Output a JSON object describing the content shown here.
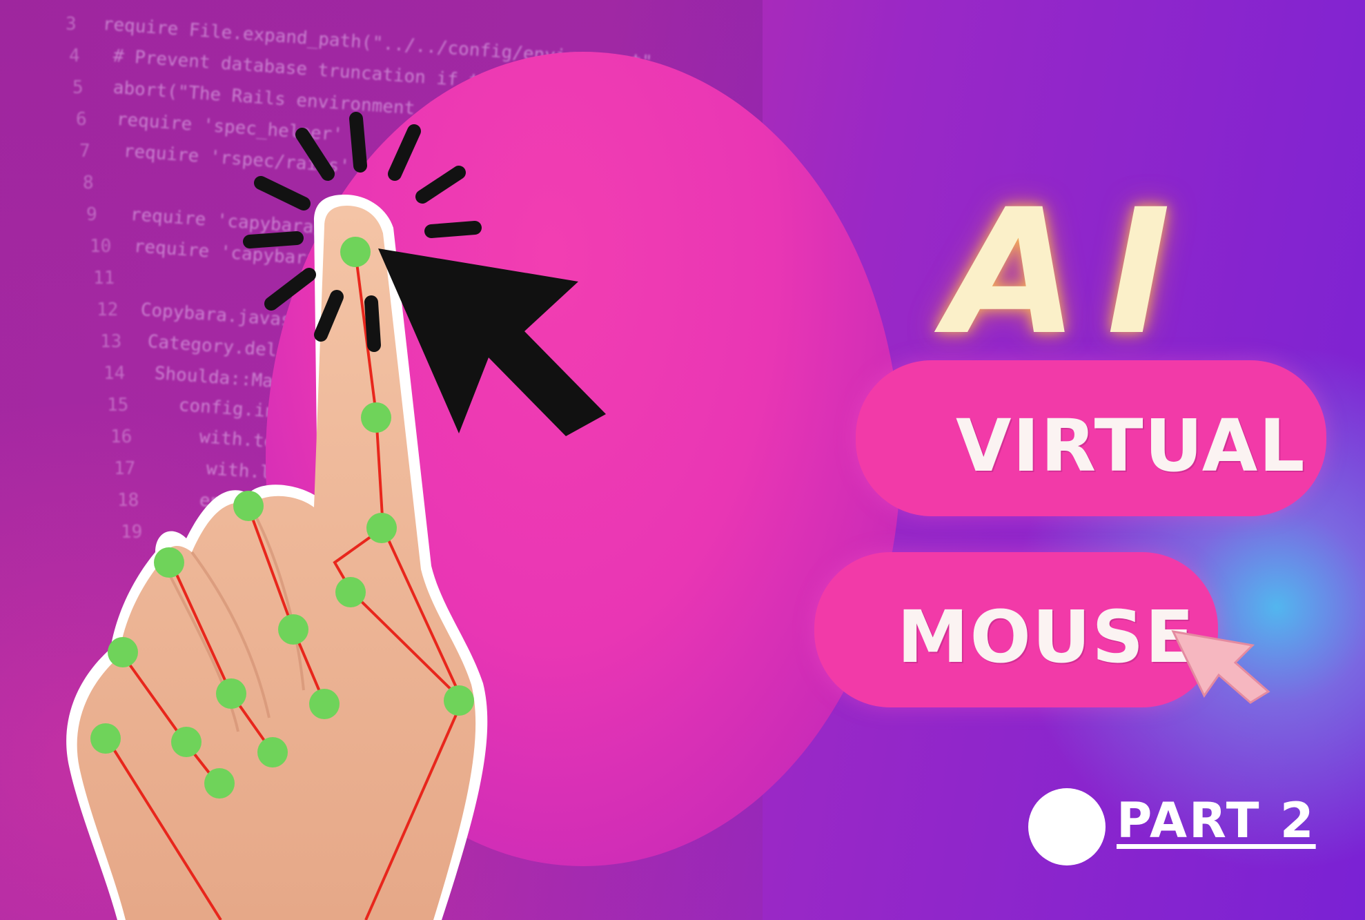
{
  "thumbnail": {
    "title_ai": "AI",
    "pill_1": "VIRTUAL",
    "pill_2": "MOUSE",
    "part_label": "PART 2"
  },
  "code_background": {
    "lines": [
      "require File.expand_path(\"../../config/environment\",",
      "# Prevent database truncation if the environment is",
      "abort(\"The Rails environment is running",
      "require 'spec_helper'",
      "require 'rspec/rails'",
      "",
      "require 'capybara/rails'",
      "require 'capybara/rspec'",
      "",
      "Copybara.javascript_driver",
      "Category.delete_all;",
      "Shoulda::Matchers.configure",
      "config.integrate",
      "with.test_framework",
      "with.library",
      "end"
    ],
    "line_numbers": [
      "3",
      "4",
      "5",
      "6",
      "7",
      "8",
      "9",
      "10",
      "11",
      "12",
      "13",
      "14",
      "15",
      "16",
      "17",
      "18",
      "19"
    ]
  },
  "colors": {
    "pill": "#f23aa8",
    "title_glow": "#fbf0c9",
    "landmark_dot": "#6fd35a",
    "landmark_line": "#e8261c",
    "cursor_dark": "#111111",
    "cursor_small": "#f6b7c0"
  },
  "icons": [
    "hand-landmarks-illustration",
    "click-burst-icon",
    "large-cursor-icon",
    "small-cursor-icon",
    "part-dot-icon"
  ]
}
